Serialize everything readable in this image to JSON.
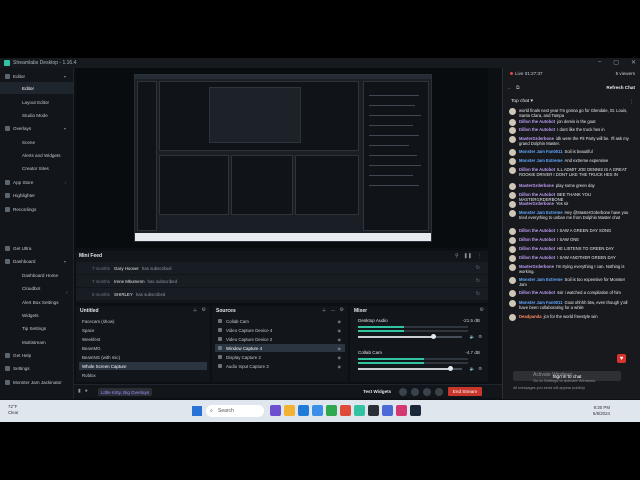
{
  "app": {
    "title": "Streamlabs Desktop - 1.16.4",
    "window_buttons": [
      "–",
      "▢",
      "✕"
    ]
  },
  "nav": {
    "items": [
      {
        "label": "Editor",
        "icon": "layout-icon",
        "level": 0,
        "chevron": "▾"
      },
      {
        "label": "Editor",
        "icon": "",
        "level": 1,
        "active": true
      },
      {
        "label": "Layout Editor",
        "icon": "",
        "level": 1
      },
      {
        "label": "Studio Mode",
        "icon": "",
        "level": 1
      },
      {
        "label": "Overlays",
        "icon": "overlays-icon",
        "level": 0,
        "chevron": "▾"
      },
      {
        "label": "Scene",
        "icon": "",
        "level": 1
      },
      {
        "label": "Alerts and Widgets",
        "icon": "",
        "level": 1
      },
      {
        "label": "Creator Sites",
        "icon": "",
        "level": 1
      },
      {
        "label": "App Store",
        "icon": "store-icon",
        "level": 0,
        "chevron": "›"
      },
      {
        "label": "Highlighter",
        "icon": "highlighter-icon",
        "level": 0
      },
      {
        "label": "Recordings",
        "icon": "recordings-icon",
        "level": 0
      },
      {
        "label": "Get Ultra",
        "icon": "ultra-icon",
        "level": 0
      },
      {
        "label": "Dashboard",
        "icon": "dashboard-icon",
        "level": 0,
        "chevron": "▾"
      },
      {
        "label": "Dashboard Home",
        "icon": "",
        "level": 1
      },
      {
        "label": "Cloudbot",
        "icon": "",
        "level": 1
      },
      {
        "label": "Alert Box Settings",
        "icon": "",
        "level": 1
      },
      {
        "label": "Widgets",
        "icon": "",
        "level": 1
      },
      {
        "label": "Tip Settings",
        "icon": "",
        "level": 1
      },
      {
        "label": "Multistream",
        "icon": "",
        "level": 1
      },
      {
        "label": "Get Help",
        "icon": "help-icon",
        "level": 0
      },
      {
        "label": "Settings",
        "icon": "settings-icon",
        "level": 0
      },
      {
        "label": "Monster Jam Jackinator",
        "icon": "avatar-icon",
        "level": 0
      }
    ],
    "collapse_glyph": "‹"
  },
  "minifeed": {
    "title": "Mini Feed",
    "rows": [
      {
        "ago": "7 months",
        "who": "Gary Hoover",
        "what": "has subscribed"
      },
      {
        "ago": "7 months",
        "who": "Irene Mkumenn",
        "what": "has subscribed"
      },
      {
        "ago": "8 months",
        "who": "SHIRLEY",
        "what": "has subscribed"
      }
    ]
  },
  "scenes": {
    "title": "Untitled",
    "items": [
      "Facecam (show)",
      "Space",
      "Weekfest",
      "BeamMG",
      "BeamNG (with mic)",
      "Whole Screen Capture",
      "Roblox"
    ],
    "selected_index": 5
  },
  "sources": {
    "title": "Sources",
    "items": [
      "Collab Cam",
      "Video Capture Device 4",
      "Video Capture Device 2",
      "Window Capture 4",
      "Display Capture 2",
      "Audio Input Capture 3"
    ],
    "selected_index": 3
  },
  "mixer": {
    "title": "Mixer",
    "channels": [
      {
        "name": "Desktop Audio",
        "db": "-21.5 dB",
        "level": 0.42,
        "volume": 0.72
      },
      {
        "name": "Collab Cam",
        "db": "-4.7 dB",
        "level": 0.6,
        "volume": 0.88
      }
    ]
  },
  "statusbar": {
    "account": "Little Kitty, Big Overlays",
    "test_widgets": "Test Widgets",
    "end_stream": "End Stream"
  },
  "chat": {
    "live_time": "Live 01:27:37",
    "viewers": "5 viewers",
    "refresh": "Refresh Chat",
    "mode": "Top chat",
    "messages": [
      {
        "user": "",
        "text": "world finals next year I'm gonna go for Glendale, St. Louis, Santa Clara, and Tampa",
        "color": "c1"
      },
      {
        "user": "Dillon the Autobot",
        "text": "jon demis is the goat",
        "color": "c1"
      },
      {
        "user": "Dillon the Autobot",
        "text": "I dont like the truck hes in",
        "color": "c1"
      },
      {
        "user": "MasterGrderbone",
        "text": "idk were the Pit Party will be. I'll ask my grand Dolphin Master.",
        "color": "c1"
      },
      {
        "user": "Monster Jam Fan0011",
        "text": "Soil is beautiful",
        "color": "c2"
      },
      {
        "user": "Monster Jam Extreme",
        "text": "And extreme expensive",
        "color": "c2"
      },
      {
        "user": "Dillon the Autobot",
        "text": "ILL ADMIT JOE DENNIS IS A GREAT ROOKIE DRIVER I DONT LIKE THE TRUCK HES IN",
        "color": "c1"
      },
      {
        "user": "MasterGrderbone",
        "text": "play some green day",
        "color": "c1"
      },
      {
        "user": "Dillon the Autobot",
        "text": "BEE THANK YOU MASTERGRDERBONE",
        "color": "c1"
      },
      {
        "user": "MasterGrderbone",
        "text": "Yes sir",
        "color": "c1"
      },
      {
        "user": "Monster Jam Extreme",
        "text": "Hey @MasterGrderbone have you tried everything to unban me from Dolphin Master chat",
        "color": "c2"
      },
      {
        "user": "Dillon the Autobot",
        "text": "I SAW A GREEN DAY SONG",
        "color": "c1"
      },
      {
        "user": "Dillon the Autobot",
        "text": "I SAW ONE",
        "color": "c1"
      },
      {
        "user": "Dillon the Autobot",
        "text": "HE LISTENS TO GREEN DAY",
        "color": "c1"
      },
      {
        "user": "Dillon the Autobot",
        "text": "I SAW ANOTHER GREEN DAY",
        "color": "c1"
      },
      {
        "user": "MasterGrderbone",
        "text": "I'm trying everything I can. Nothing is working.",
        "color": "c1"
      },
      {
        "user": "Monster Jam Extreme",
        "text": "Soil is too expensive for Monster Jam",
        "color": "c2"
      },
      {
        "user": "Dillon the Autobot",
        "text": "ssir i watched a compilation of him",
        "color": "c1"
      },
      {
        "user": "Monster Jam Fan0011",
        "text": "Goat ohhhh btw, even though y'all have been collaborating for a while",
        "color": "c2"
      },
      {
        "user": "Deadpanda",
        "text": "jcn for the world freestyle win",
        "color": "c3"
      }
    ],
    "sign_in": "Sign in to chat",
    "footer": "All messages you send will appear publicly"
  },
  "watermark": {
    "line1": "Activate Windows",
    "line2": "Go to Settings to activate Windows."
  },
  "taskbar": {
    "weather_temp": "72°F",
    "weather_desc": "Clear",
    "search_placeholder": "Search",
    "time": "9:30 PM",
    "date": "5/8/2024"
  }
}
